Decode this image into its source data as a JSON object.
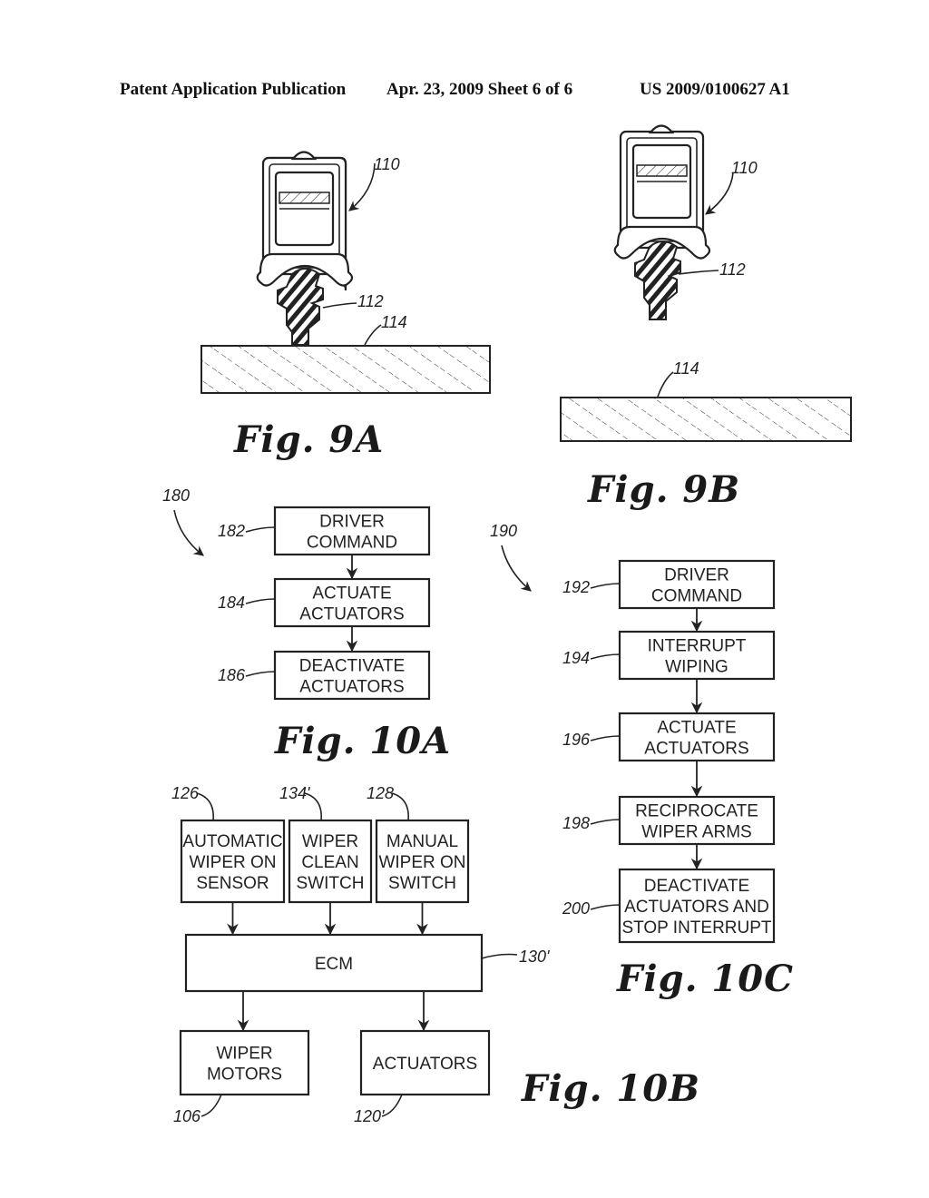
{
  "header": {
    "left": "Patent Application Publication",
    "center": "Apr. 23, 2009  Sheet 6 of 6",
    "right": "US 2009/0100627 A1"
  },
  "fig9a": {
    "label": "Fig. 9A",
    "refs": {
      "assembly": "110",
      "blade": "112",
      "windshield": "114"
    }
  },
  "fig9b": {
    "label": "Fig. 9B",
    "refs": {
      "assembly": "110",
      "blade": "112",
      "windshield": "114"
    }
  },
  "fig10a": {
    "label": "Fig. 10A",
    "ref": "180",
    "steps": [
      {
        "ref": "182",
        "lines": [
          "DRIVER",
          "COMMAND"
        ]
      },
      {
        "ref": "184",
        "lines": [
          "ACTUATE",
          "ACTUATORS"
        ]
      },
      {
        "ref": "186",
        "lines": [
          "DEACTIVATE",
          "ACTUATORS"
        ]
      }
    ]
  },
  "fig10b": {
    "label": "Fig. 10B",
    "inputs": [
      {
        "ref": "126",
        "lines": [
          "AUTOMATIC",
          "WIPER ON",
          "SENSOR"
        ]
      },
      {
        "ref": "134'",
        "lines": [
          "WIPER",
          "CLEAN",
          "SWITCH"
        ]
      },
      {
        "ref": "128",
        "lines": [
          "MANUAL",
          "WIPER ON",
          "SWITCH"
        ]
      }
    ],
    "controller": {
      "ref": "130'",
      "label": "ECM"
    },
    "outputs": [
      {
        "ref": "106",
        "lines": [
          "WIPER",
          "MOTORS"
        ]
      },
      {
        "ref": "120'",
        "lines": [
          "ACTUATORS"
        ]
      }
    ]
  },
  "fig10c": {
    "label": "Fig. 10C",
    "ref": "190",
    "steps": [
      {
        "ref": "192",
        "lines": [
          "DRIVER",
          "COMMAND"
        ]
      },
      {
        "ref": "194",
        "lines": [
          "INTERRUPT",
          "WIPING"
        ]
      },
      {
        "ref": "196",
        "lines": [
          "ACTUATE",
          "ACTUATORS"
        ]
      },
      {
        "ref": "198",
        "lines": [
          "RECIPROCATE",
          "WIPER ARMS"
        ]
      },
      {
        "ref": "200",
        "lines": [
          "DEACTIVATE",
          "ACTUATORS AND",
          "STOP INTERRUPT"
        ]
      }
    ]
  }
}
